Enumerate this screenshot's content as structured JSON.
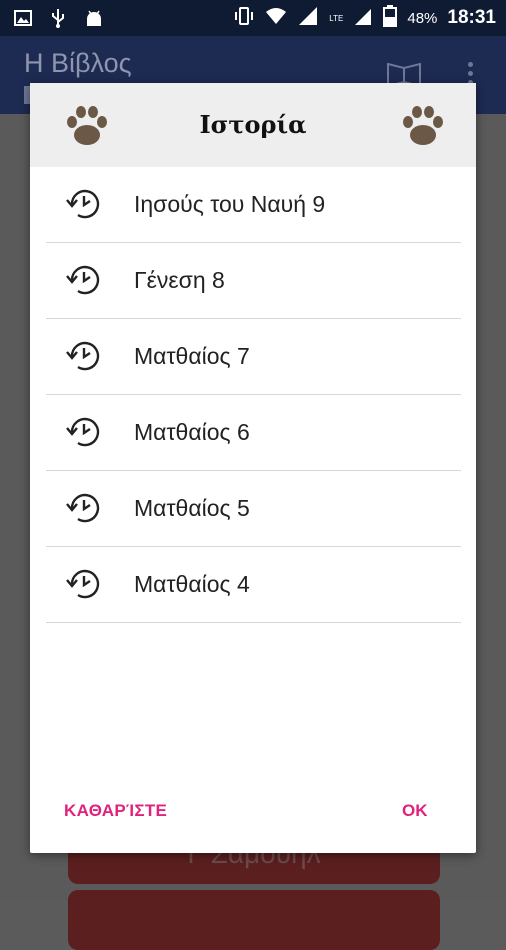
{
  "status_bar": {
    "battery_percent": "48%",
    "time": "18:31",
    "network_label": "LTE"
  },
  "app_bar": {
    "title": "Η Βίβλος"
  },
  "background": {
    "button_label": "Γ Σαμουήλ"
  },
  "dialog": {
    "title": "Ιστορία",
    "items": [
      {
        "label": "Ιησούς του Ναυή 9"
      },
      {
        "label": "Γένεση 8"
      },
      {
        "label": "Ματθαίος 7"
      },
      {
        "label": "Ματθαίος 6"
      },
      {
        "label": "Ματθαίος 5"
      },
      {
        "label": "Ματθαίος 4"
      }
    ],
    "clear_label": "ΚΑΘΑΡΊΣΤΕ",
    "ok_label": "OK"
  },
  "colors": {
    "accent": "#e0227c",
    "status_bar": "#0f1a33",
    "app_bar": "#1d2a52",
    "paw": "#6b5846"
  },
  "icons": [
    "image-icon",
    "usb-icon",
    "android-icon",
    "vibrate-icon",
    "wifi-icon",
    "signal-icon",
    "battery-icon",
    "book-icon",
    "more-icon",
    "paw-icon",
    "history-icon"
  ]
}
